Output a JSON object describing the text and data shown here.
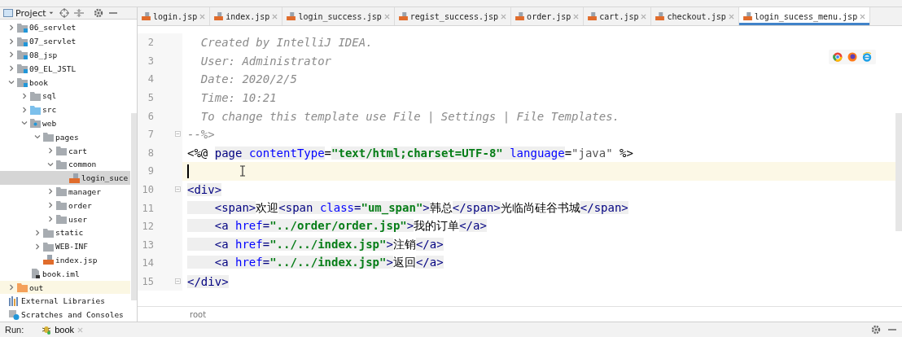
{
  "project_panel": {
    "title": "Project"
  },
  "tree": [
    {
      "label": "06_servlet",
      "kind": "module",
      "expanded": false,
      "selected": false
    },
    {
      "label": "07_servlet",
      "kind": "module",
      "expanded": false,
      "selected": false
    },
    {
      "label": "08_jsp",
      "kind": "module",
      "expanded": false,
      "selected": false
    },
    {
      "label": "09_EL_JSTL",
      "kind": "module",
      "expanded": false,
      "selected": false
    },
    {
      "label": "book",
      "kind": "module",
      "expanded": true,
      "selected": false,
      "children": [
        {
          "label": "sql",
          "kind": "folder",
          "expanded": false,
          "selected": false
        },
        {
          "label": "src",
          "kind": "source",
          "expanded": false,
          "selected": false
        },
        {
          "label": "web",
          "kind": "web",
          "expanded": true,
          "selected": false,
          "children": [
            {
              "label": "pages",
              "kind": "folder",
              "expanded": true,
              "selected": false,
              "children": [
                {
                  "label": "cart",
                  "kind": "folder",
                  "expanded": false,
                  "selected": false
                },
                {
                  "label": "common",
                  "kind": "folder",
                  "expanded": true,
                  "selected": false,
                  "children": [
                    {
                      "label": "login_suce",
                      "kind": "jsp",
                      "selected": true
                    }
                  ]
                },
                {
                  "label": "manager",
                  "kind": "folder",
                  "expanded": false,
                  "selected": false
                },
                {
                  "label": "order",
                  "kind": "folder",
                  "expanded": false,
                  "selected": false
                },
                {
                  "label": "user",
                  "kind": "folder",
                  "expanded": false,
                  "selected": false
                }
              ]
            },
            {
              "label": "static",
              "kind": "folder",
              "expanded": false,
              "selected": false
            },
            {
              "label": "WEB-INF",
              "kind": "folder",
              "expanded": false,
              "selected": false
            },
            {
              "label": "index.jsp",
              "kind": "jsp",
              "selected": false
            }
          ]
        },
        {
          "label": "book.iml",
          "kind": "iml",
          "selected": false
        }
      ]
    },
    {
      "label": "out",
      "kind": "excluded",
      "expanded": false,
      "selected": false
    }
  ],
  "extra_roots": [
    {
      "label": "External Libraries",
      "kind": "libraries"
    },
    {
      "label": "Scratches and Consoles",
      "kind": "scratches"
    }
  ],
  "tabs": [
    {
      "label": "login.jsp",
      "selected": false
    },
    {
      "label": "index.jsp",
      "selected": false
    },
    {
      "label": "login_success.jsp",
      "selected": false
    },
    {
      "label": "regist_success.jsp",
      "selected": false
    },
    {
      "label": "order.jsp",
      "selected": false
    },
    {
      "label": "cart.jsp",
      "selected": false
    },
    {
      "label": "checkout.jsp",
      "selected": false
    },
    {
      "label": "login_sucess_menu.jsp",
      "selected": true
    }
  ],
  "code_lines": [
    {
      "number": "2",
      "tokens": [
        {
          "kind": "comment",
          "text": "  Created by IntelliJ IDEA."
        }
      ]
    },
    {
      "number": "3",
      "tokens": [
        {
          "kind": "comment",
          "text": "  User: Administrator"
        }
      ]
    },
    {
      "number": "4",
      "tokens": [
        {
          "kind": "comment",
          "text": "  Date: 2020/2/5"
        }
      ]
    },
    {
      "number": "5",
      "tokens": [
        {
          "kind": "comment",
          "text": "  Time: 10:21"
        }
      ]
    },
    {
      "number": "6",
      "tokens": [
        {
          "kind": "comment",
          "text": "  To change this template use File | Settings | File Templates."
        }
      ]
    },
    {
      "number": "7",
      "fold": true,
      "tokens": [
        {
          "kind": "comment",
          "text": "--%>"
        }
      ]
    },
    {
      "number": "8",
      "tokens": [
        {
          "kind": "punct",
          "text": "<%@ "
        },
        {
          "kind": "tag",
          "text": "page "
        },
        {
          "kind": "attr",
          "text": "contentType"
        },
        {
          "kind": "punct",
          "text": "="
        },
        {
          "kind": "value",
          "text": "\"text/html;charset=UTF-8\" "
        },
        {
          "kind": "attr",
          "text": "language"
        },
        {
          "kind": "punct",
          "text": "="
        },
        {
          "kind": "plainvalue",
          "text": "\"java\""
        },
        {
          "kind": "punct",
          "text": " %>"
        }
      ]
    },
    {
      "number": "9",
      "current": true
    },
    {
      "number": "10",
      "fold": true,
      "tokens": [
        {
          "kind": "tag",
          "text": "<div>"
        }
      ]
    },
    {
      "number": "11",
      "tokens": [
        {
          "kind": "tag",
          "text": "    <span>"
        },
        {
          "kind": "text",
          "text": "欢迎"
        },
        {
          "kind": "tag",
          "text": "<span "
        },
        {
          "kind": "attr",
          "text": "class"
        },
        {
          "kind": "tag",
          "text": "="
        },
        {
          "kind": "value",
          "text": "\"um_span\""
        },
        {
          "kind": "tag",
          "text": ">"
        },
        {
          "kind": "text",
          "text": "韩总"
        },
        {
          "kind": "tag",
          "text": "</span>"
        },
        {
          "kind": "text",
          "text": "光临尚硅谷书城"
        },
        {
          "kind": "tag",
          "text": "</span>"
        }
      ]
    },
    {
      "number": "12",
      "tokens": [
        {
          "kind": "tag",
          "text": "    <a "
        },
        {
          "kind": "attr",
          "text": "href"
        },
        {
          "kind": "tag",
          "text": "="
        },
        {
          "kind": "value",
          "text": "\"../order/order.jsp\""
        },
        {
          "kind": "tag",
          "text": ">"
        },
        {
          "kind": "text",
          "text": "我的订单"
        },
        {
          "kind": "tag",
          "text": "</a>"
        }
      ]
    },
    {
      "number": "13",
      "tokens": [
        {
          "kind": "tag",
          "text": "    <a "
        },
        {
          "kind": "attr",
          "text": "href"
        },
        {
          "kind": "tag",
          "text": "="
        },
        {
          "kind": "value",
          "text": "\"../../index.jsp\""
        },
        {
          "kind": "tag",
          "text": ">"
        },
        {
          "kind": "text",
          "text": "注销"
        },
        {
          "kind": "tag",
          "text": "</a>"
        }
      ]
    },
    {
      "number": "14",
      "tokens": [
        {
          "kind": "tag",
          "text": "    <a "
        },
        {
          "kind": "attr",
          "text": "href"
        },
        {
          "kind": "tag",
          "text": "="
        },
        {
          "kind": "value",
          "text": "\"../../index.jsp\""
        },
        {
          "kind": "tag",
          "text": ">"
        },
        {
          "kind": "text",
          "text": "返回"
        },
        {
          "kind": "tag",
          "text": "</a>"
        }
      ]
    },
    {
      "number": "15",
      "fold": true,
      "tokens": [
        {
          "kind": "tag",
          "text": "</div>"
        }
      ]
    }
  ],
  "breadcrumb": "root",
  "run_bar": {
    "label": "Run:",
    "config": "book"
  }
}
